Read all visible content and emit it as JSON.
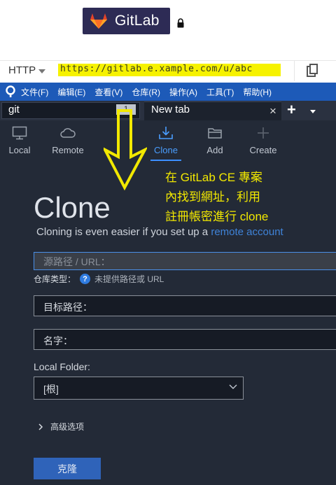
{
  "gitlab": {
    "logo_text": "GitLab",
    "protocol": "HTTP",
    "url_text": "https://gitlab.e.xample.com/u/abc",
    "highlight_color": "#f6f200"
  },
  "menu": {
    "items": [
      "文件(F)",
      "编辑(E)",
      "查看(V)",
      "仓库(R)",
      "操作(A)",
      "工具(T)",
      "帮助(H)"
    ]
  },
  "tabs": {
    "search_value": "git",
    "search_count": "1",
    "new_tab_label": "New tab",
    "close_glyph": "×",
    "add_glyph": "+"
  },
  "toolbar": {
    "local": "Local",
    "remote": "Remote",
    "clone": "Clone",
    "add": "Add",
    "create": "Create"
  },
  "annotation": {
    "lines": [
      "在 GitLab CE 專案",
      "內找到網址，利用",
      "註冊帳密進行 clone"
    ],
    "color": "#f2e800"
  },
  "clone": {
    "title": "Clone",
    "subtitle": "Cloning is even easier if you set up a",
    "remote_link": "remote account",
    "source_placeholder": "源路径 / URL：",
    "repo_type_label": "仓库类型：",
    "repo_type_value": "未提供路径或 URL",
    "dest_label": "目标路径：",
    "name_label": "名字：",
    "local_folder_label": "Local Folder:",
    "local_folder_value": "[根]",
    "advanced_label": "高级选项",
    "clone_button": "克隆"
  }
}
